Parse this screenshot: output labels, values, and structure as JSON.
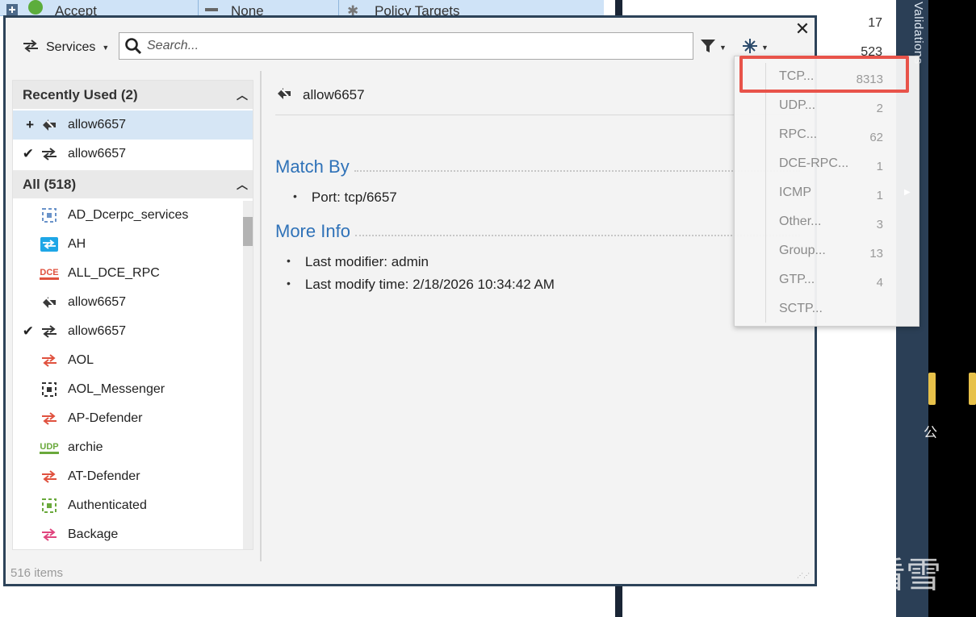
{
  "background": {
    "top_row": {
      "action": "Accept",
      "col2": "None",
      "col3": "Policy Targets"
    },
    "counts": [
      "17",
      "523"
    ],
    "vertical_label": "Validations",
    "cjk_char": "公",
    "watermark_text": "看雪"
  },
  "dialog": {
    "services_label": "Services",
    "search_placeholder": "Search...",
    "close_symbol": "✕"
  },
  "left_list": {
    "recent_header": "Recently Used (2)",
    "all_header": "All (518)",
    "recent": [
      {
        "label": "allow6657",
        "lead": "+",
        "icon": "tcp-service-icon"
      },
      {
        "label": "allow6657",
        "lead": "✔",
        "icon": "service-arrows-icon"
      }
    ],
    "all": [
      {
        "label": "AD_Dcerpc_services",
        "icon": "service-group-icon"
      },
      {
        "label": "AH",
        "icon": "ah-service-icon"
      },
      {
        "label": "ALL_DCE_RPC",
        "icon": "dce-icon",
        "icon_text": "DCE"
      },
      {
        "label": "allow6657",
        "icon": "tcp-service-icon"
      },
      {
        "label": "allow6657",
        "icon": "service-arrows-icon",
        "lead": "✔"
      },
      {
        "label": "AOL",
        "icon": "service-arrows-red-icon"
      },
      {
        "label": "AOL_Messenger",
        "icon": "service-group-icon"
      },
      {
        "label": "AP-Defender",
        "icon": "service-arrows-red-icon"
      },
      {
        "label": "archie",
        "icon": "udp-icon",
        "icon_text": "UDP"
      },
      {
        "label": "AT-Defender",
        "icon": "service-arrows-red-icon"
      },
      {
        "label": "Authenticated",
        "icon": "service-group-green-icon"
      },
      {
        "label": "Backage",
        "icon": "service-arrows-pink-icon"
      }
    ],
    "footer": "516 items"
  },
  "detail": {
    "title": "allow6657",
    "match_by": "Match By",
    "port_key": "Port:",
    "port_value": "tcp/6657",
    "more_info": "More Info",
    "modifier_key": "Last modifier:",
    "modifier_value": "admin",
    "modify_time_key": "Last modify time:",
    "modify_time_value": "2/18/2026 10:34:42 AM"
  },
  "dropdown": {
    "items": [
      {
        "label": "TCP...",
        "count": "8313"
      },
      {
        "label": "UDP...",
        "count": "2"
      },
      {
        "label": "RPC...",
        "count": "62"
      },
      {
        "label": "DCE-RPC...",
        "count": "1"
      },
      {
        "label": "ICMP",
        "count": "1"
      },
      {
        "label": "Other...",
        "count": "3"
      },
      {
        "label": "Group...",
        "count": "13"
      },
      {
        "label": "GTP...",
        "count": "4"
      },
      {
        "label": "SCTP...",
        "count": ""
      }
    ]
  },
  "colors": {
    "accent": "#2f72b8",
    "highlight": "#e8534a",
    "dialog_border": "#2d4359"
  }
}
